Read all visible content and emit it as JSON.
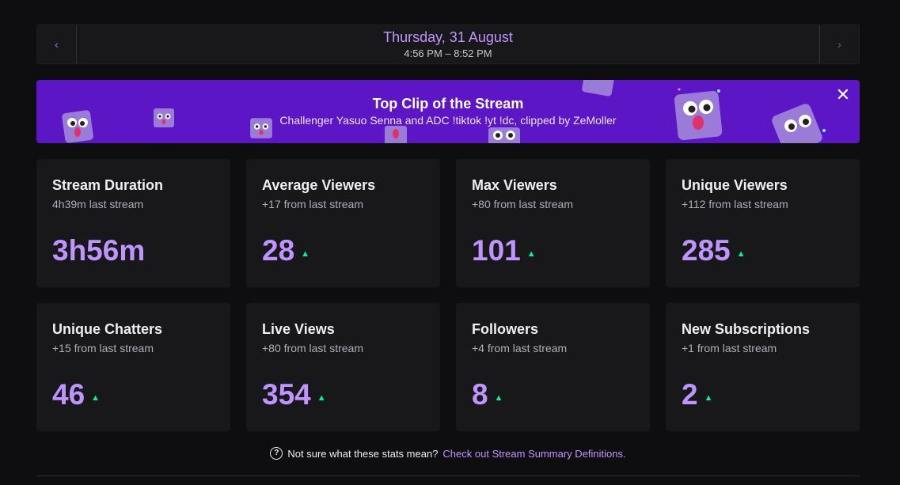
{
  "date_nav": {
    "prev_icon": "chevron-left",
    "next_icon": "chevron-right",
    "date": "Thursday, 31 August",
    "time_range": "4:56 PM – 8:52 PM"
  },
  "clip_banner": {
    "title": "Top Clip of the Stream",
    "subtitle": "Challenger Yasuo Senna and ADC !tiktok !yt !dc, clipped by ZeMoller",
    "close_icon": "close",
    "background": "#5c16c5"
  },
  "stats": [
    {
      "title": "Stream Duration",
      "sub": "4h39m last stream",
      "value": "3h56m",
      "trend": ""
    },
    {
      "title": "Average Viewers",
      "sub": "+17 from last stream",
      "value": "28",
      "trend": "up"
    },
    {
      "title": "Max Viewers",
      "sub": "+80 from last stream",
      "value": "101",
      "trend": "up"
    },
    {
      "title": "Unique Viewers",
      "sub": "+112 from last stream",
      "value": "285",
      "trend": "up"
    },
    {
      "title": "Unique Chatters",
      "sub": "+15 from last stream",
      "value": "46",
      "trend": "up"
    },
    {
      "title": "Live Views",
      "sub": "+80 from last stream",
      "value": "354",
      "trend": "up"
    },
    {
      "title": "Followers",
      "sub": "+4 from last stream",
      "value": "8",
      "trend": "up"
    },
    {
      "title": "New Subscriptions",
      "sub": "+1 from last stream",
      "value": "2",
      "trend": "up"
    }
  ],
  "help": {
    "icon": "question-circle",
    "text": "Not sure what these stats mean?",
    "link": "Check out Stream Summary Definitions."
  },
  "colors": {
    "accent": "#bf94ff",
    "trend_up": "#00f593",
    "card_bg": "#18181b",
    "page_bg": "#0e0e10"
  }
}
